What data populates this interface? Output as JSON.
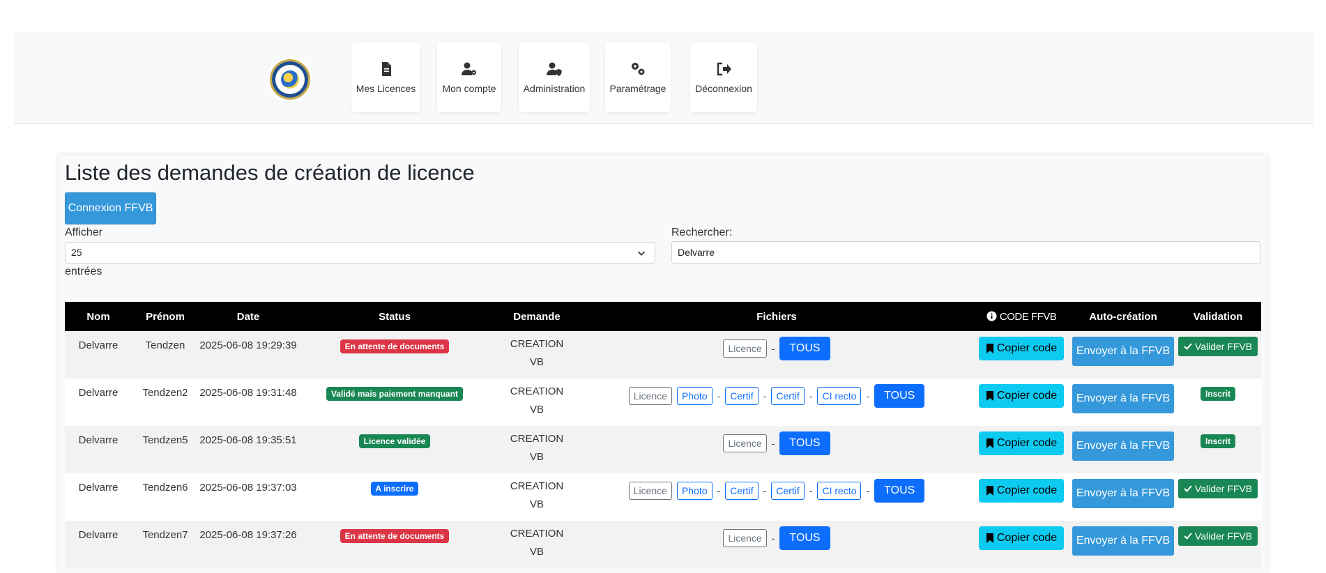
{
  "nav": {
    "items": [
      {
        "label": "Mes Licences",
        "icon": "document-icon"
      },
      {
        "label": "Mon compte",
        "icon": "user-gear-icon"
      },
      {
        "label": "Administration",
        "icon": "user-shield-icon"
      },
      {
        "label": "Paramétrage",
        "icon": "gears-icon"
      },
      {
        "label": "Déconnexion",
        "icon": "sign-out-icon"
      }
    ]
  },
  "page": {
    "title": "Liste des demandes de création de licence",
    "connect_button": "Connexion FFVB",
    "show_label": "Afficher",
    "show_value": "25",
    "entries_label": "entrées",
    "search_label": "Rechercher:",
    "search_value": "Delvarre"
  },
  "table": {
    "headers": {
      "nom": "Nom",
      "prenom": "Prénom",
      "date": "Date",
      "status": "Status",
      "demande": "Demande",
      "fichiers": "Fichiers",
      "code": "CODE FFVB",
      "auto": "Auto-création",
      "validation": "Validation"
    },
    "labels": {
      "licence": "Licence",
      "photo": "Photo",
      "certif": "Certif",
      "ci_recto": "CI recto",
      "tous": "TOUS",
      "sep": "-",
      "copy": "Copier code",
      "send": "Envoyer à la FFVB",
      "valider": "Valider FFVB",
      "inscrit": "Inscrit",
      "demande_1": "CREATION",
      "demande_2": "VB"
    },
    "rows": [
      {
        "nom": "Delvarre",
        "prenom": "Tendzen",
        "date": "2025-06-08 19:29:39",
        "status": "En attente de documents"
      },
      {
        "nom": "Delvarre",
        "prenom": "Tendzen2",
        "date": "2025-06-08 19:31:48",
        "status": "Validé mais paiement manquant"
      },
      {
        "nom": "Delvarre",
        "prenom": "Tendzen5",
        "date": "2025-06-08 19:35:51",
        "status": "Licence validée"
      },
      {
        "nom": "Delvarre",
        "prenom": "Tendzen6",
        "date": "2025-06-08 19:37:03",
        "status": "A inscrire"
      },
      {
        "nom": "Delvarre",
        "prenom": "Tendzen7",
        "date": "2025-06-08 19:37:26",
        "status": "En attente de documents"
      }
    ]
  },
  "colors": {
    "primary": "#0d6efd",
    "info": "#0dcaf0",
    "success": "#198754",
    "danger": "#dc3545",
    "ffvb_blue": "#3498db"
  }
}
